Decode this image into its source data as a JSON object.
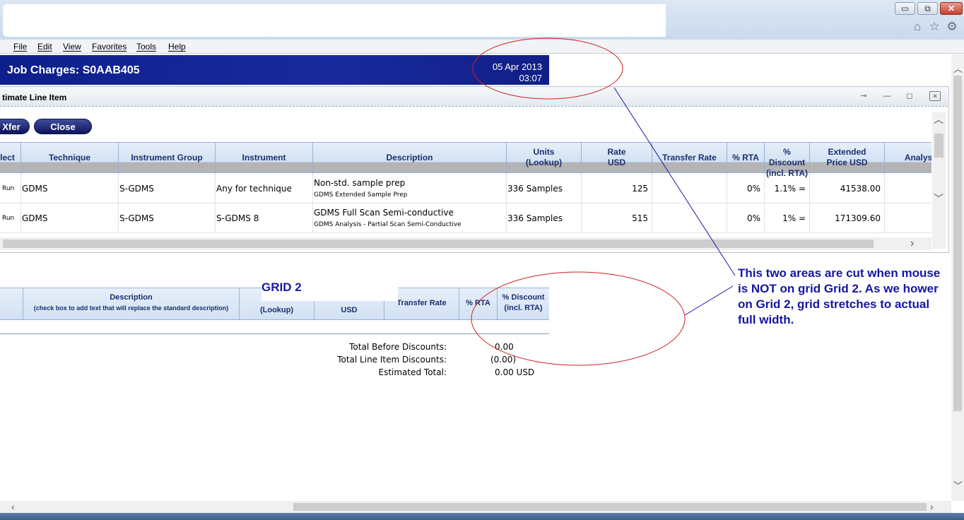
{
  "browser": {
    "window_controls": {
      "minimize": "▭",
      "maximize": "⧉",
      "close": "✕"
    },
    "toolbar_icons": [
      "home-icon",
      "favorites-icon",
      "tools-icon"
    ],
    "menu": [
      "File",
      "Edit",
      "View",
      "Favorites",
      "Tools",
      "Help"
    ]
  },
  "page": {
    "title": "Job Charges: S0AAB405",
    "date": "05 Apr 2013",
    "time": "03:07"
  },
  "dialog": {
    "title": "timate Line Item",
    "buttons": {
      "xfer": "Xfer",
      "close": "Close"
    }
  },
  "grid1": {
    "columns": [
      "lect",
      "Technique",
      "Instrument Group",
      "Instrument",
      "Description",
      "Units\n(Lookup)",
      "Rate\nUSD",
      "Transfer Rate",
      "% RTA",
      "% Discount\n(incl. RTA)",
      "Extended\nPrice USD",
      "Analyst"
    ],
    "rows": [
      {
        "select": "Run",
        "technique": "GDMS",
        "instrument_group": "S-GDMS",
        "instrument": "Any for technique",
        "description": "Non-std. sample prep",
        "description_sub": "GDMS Extended Sample Prep",
        "units": "336 Samples",
        "rate": "125",
        "transfer_rate": "",
        "rta": "0%",
        "discount": "1.1% =",
        "extended_price": "41538.00",
        "analyst": ""
      },
      {
        "select": "Run",
        "technique": "GDMS",
        "instrument_group": "S-GDMS",
        "instrument": "S-GDMS 8",
        "description": "GDMS Full Scan Semi-conductive",
        "description_sub": "GDMS Analysis - Partial Scan Semi-Conductive",
        "units": "336 Samples",
        "rate": "515",
        "transfer_rate": "",
        "rta": "0%",
        "discount": "1% =",
        "extended_price": "171309.60",
        "analyst": ""
      }
    ]
  },
  "grid2": {
    "label": "GRID 2",
    "columns": {
      "description": "Description",
      "description_sub": "(check box to add text that will replace the standard description)",
      "units": "(Lookup)",
      "rate": "USD",
      "transfer_rate": "Transfer Rate",
      "rta": "% RTA",
      "discount": "% Discount\n(incl. RTA)"
    }
  },
  "totals": [
    {
      "label": "Total Before Discounts:",
      "value": "0.00"
    },
    {
      "label": "Total Line Item Discounts:",
      "value": "(0.00)"
    },
    {
      "label": "Estimated Total:",
      "value": "0.00 USD"
    }
  ],
  "annotation": "This two areas are cut when mouse is NOT on grid Grid 2. As we hower on Grid 2, grid stretches to actual full width.",
  "colors": {
    "title_bar": "#1a2a9e",
    "grid_header_text": "#1a2f6e",
    "annotation": "#1515a6",
    "ellipse": "#d02020",
    "leader_line": "#1a1aa8"
  }
}
